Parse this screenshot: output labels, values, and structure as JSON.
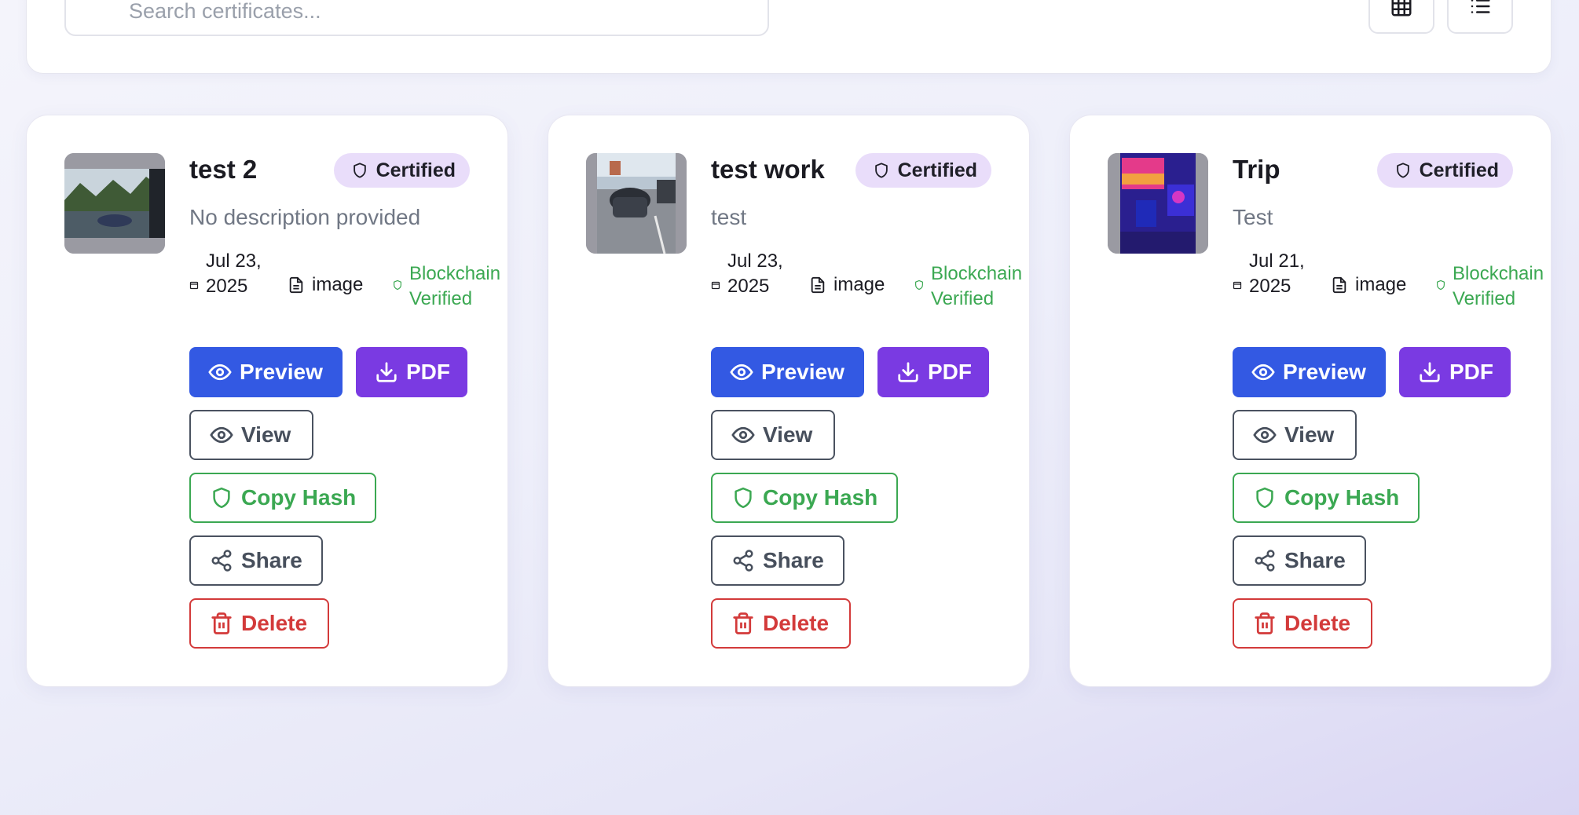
{
  "toolbar": {
    "search_placeholder": "Search certificates...",
    "grid_view_icon": "grid-icon",
    "list_view_icon": "list-icon"
  },
  "colors": {
    "preview": "#3359e3",
    "pdf": "#7a3ae2",
    "verified_green": "#3ba852",
    "delete_red": "#d33a3a",
    "badge_bg": "#e9ddfa"
  },
  "cards": [
    {
      "title": "test 2",
      "badge": "Certified",
      "description": "No description provided",
      "date": "Jul 23, 2025",
      "type": "image",
      "verification": "Blockchain Verified",
      "buttons": {
        "preview": "Preview",
        "pdf": "PDF",
        "view": "View",
        "copy_hash": "Copy Hash",
        "share": "Share",
        "delete": "Delete"
      }
    },
    {
      "title": "test work",
      "badge": "Certified",
      "description": "test",
      "date": "Jul 23, 2025",
      "type": "image",
      "verification": "Blockchain Verified",
      "buttons": {
        "preview": "Preview",
        "pdf": "PDF",
        "view": "View",
        "copy_hash": "Copy Hash",
        "share": "Share",
        "delete": "Delete"
      }
    },
    {
      "title": "Trip",
      "badge": "Certified",
      "description": "Test",
      "date": "Jul 21, 2025",
      "type": "image",
      "verification": "Blockchain Verified",
      "buttons": {
        "preview": "Preview",
        "pdf": "PDF",
        "view": "View",
        "copy_hash": "Copy Hash",
        "share": "Share",
        "delete": "Delete"
      }
    }
  ]
}
